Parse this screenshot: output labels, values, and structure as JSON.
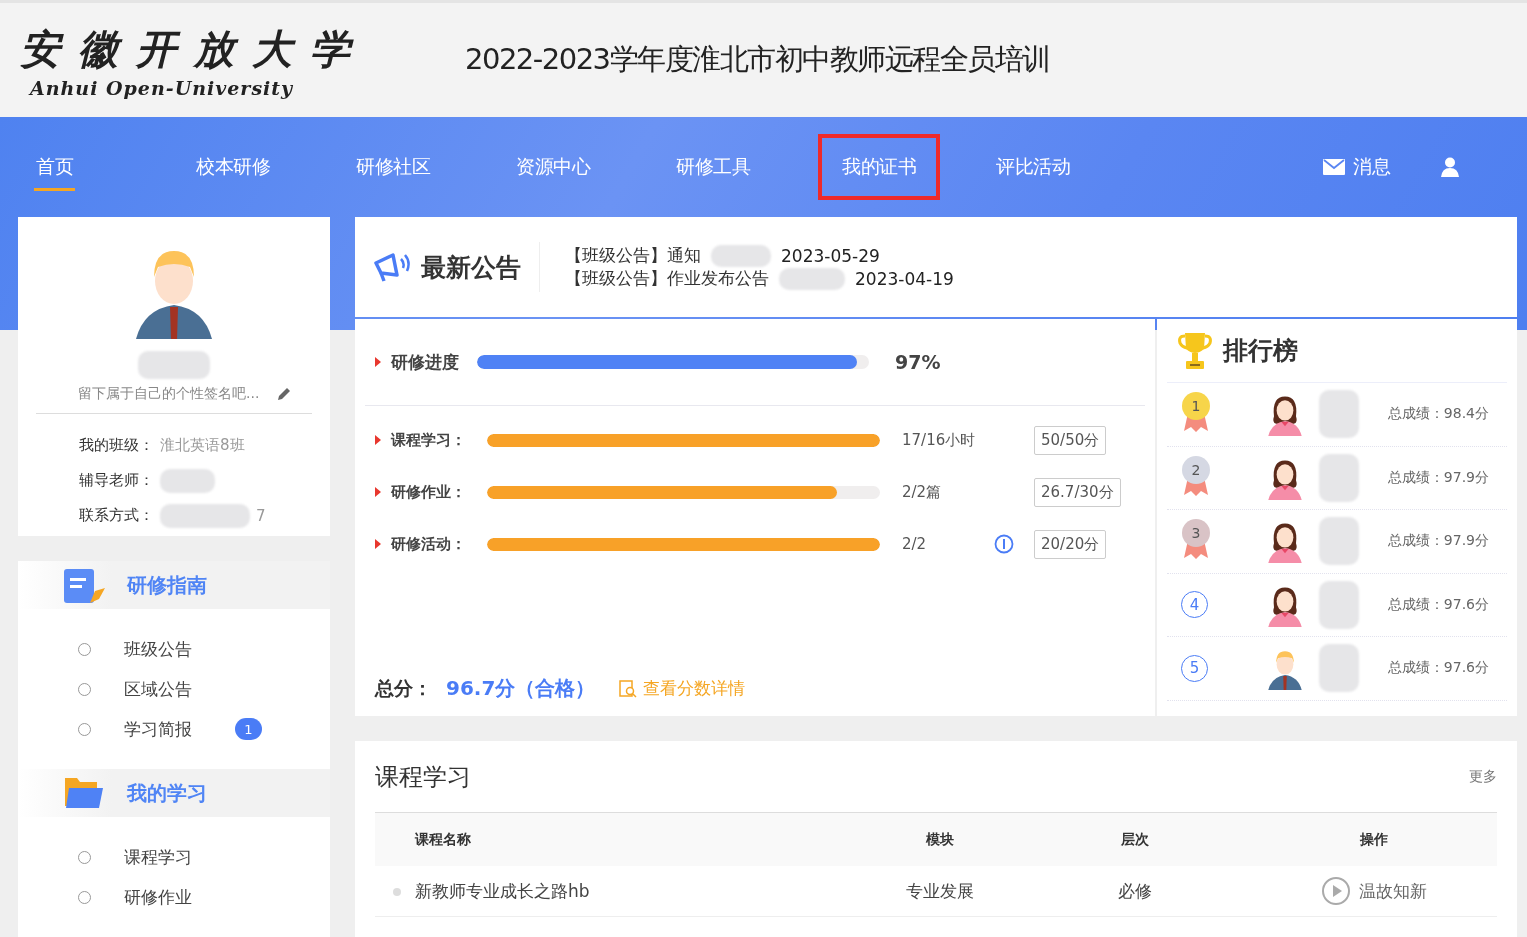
{
  "header": {
    "logo_cn": "安 徽 开 放 大 学",
    "logo_en": "Anhui Open-University",
    "title": "2022-2023学年度淮北市初中教师远程全员培训"
  },
  "nav": {
    "items": [
      {
        "label": "首页",
        "selected": true,
        "highlighted": false
      },
      {
        "label": "校本研修",
        "selected": false,
        "highlighted": false
      },
      {
        "label": "研修社区",
        "selected": false,
        "highlighted": false
      },
      {
        "label": "资源中心",
        "selected": false,
        "highlighted": false
      },
      {
        "label": "研修工具",
        "selected": false,
        "highlighted": false
      },
      {
        "label": "我的证书",
        "selected": false,
        "highlighted": true
      },
      {
        "label": "评比活动",
        "selected": false,
        "highlighted": false
      }
    ],
    "messages": "消息"
  },
  "profile": {
    "signature": "留下属于自己的个性签名吧...",
    "fields": [
      {
        "label": "我的班级：",
        "value": "淮北英语8班"
      },
      {
        "label": "辅导老师："
      },
      {
        "label": "联系方式：",
        "value": "7"
      }
    ]
  },
  "sidebar": {
    "sections": [
      {
        "title": "研修指南",
        "kind": "notepad",
        "items": [
          {
            "label": "班级公告"
          },
          {
            "label": "区域公告"
          },
          {
            "label": "学习简报",
            "badge": "1"
          }
        ]
      },
      {
        "title": "我的学习",
        "kind": "folder",
        "items": [
          {
            "label": "课程学习"
          },
          {
            "label": "研修作业"
          }
        ]
      }
    ]
  },
  "notices": {
    "title": "最新公告",
    "items": [
      {
        "text": "【班级公告】通知",
        "date": "2023-05-29"
      },
      {
        "text": "【班级公告】作业发布公告",
        "date": "2023-04-19"
      }
    ]
  },
  "progress": {
    "main": {
      "label": "研修进度",
      "level": 0.97,
      "reading": "97%"
    },
    "items": [
      {
        "label": "课程学习：",
        "level": 1,
        "reading": "17/16小时",
        "info": false,
        "score": "50/50分"
      },
      {
        "label": "研修作业：",
        "level": 0.89,
        "reading": "2/2篇",
        "info": false,
        "score": "26.7/30分"
      },
      {
        "label": "研修活动：",
        "level": 1,
        "reading": "2/2",
        "info": true,
        "score": "20/20分"
      }
    ],
    "total_label": "总分：",
    "total": "96.7分（合格）",
    "details_link": "查看分数详情"
  },
  "ranking": {
    "title": "排行榜",
    "rows": [
      {
        "rank": "1",
        "kind": "medal",
        "color": "#f7d54a",
        "avatar": {
          "kind": "female"
        },
        "score": "总成绩：98.4分"
      },
      {
        "rank": "2",
        "kind": "medal",
        "color": "#d5d8e3",
        "avatar": {
          "kind": "female"
        },
        "score": "总成绩：97.9分"
      },
      {
        "rank": "3",
        "kind": "medal",
        "color": "#d9c3c6",
        "avatar": {
          "kind": "female"
        },
        "score": "总成绩：97.9分"
      },
      {
        "rank": "4",
        "kind": "circle",
        "color": "#4a7cf6",
        "avatar": {
          "kind": "female"
        },
        "score": "总成绩：97.6分"
      },
      {
        "rank": "5",
        "kind": "circle",
        "color": "#4a7cf6",
        "avatar": {
          "kind": "male"
        },
        "score": "总成绩：97.6分"
      }
    ]
  },
  "courses": {
    "title": "课程学习",
    "more": "更多",
    "columns": [
      "课程名称",
      "模块",
      "层次",
      "操作"
    ],
    "rows": [
      {
        "name": "新教师专业成长之路hb",
        "module": "专业发展",
        "level_text": "必修",
        "action": "温故知新"
      }
    ]
  }
}
